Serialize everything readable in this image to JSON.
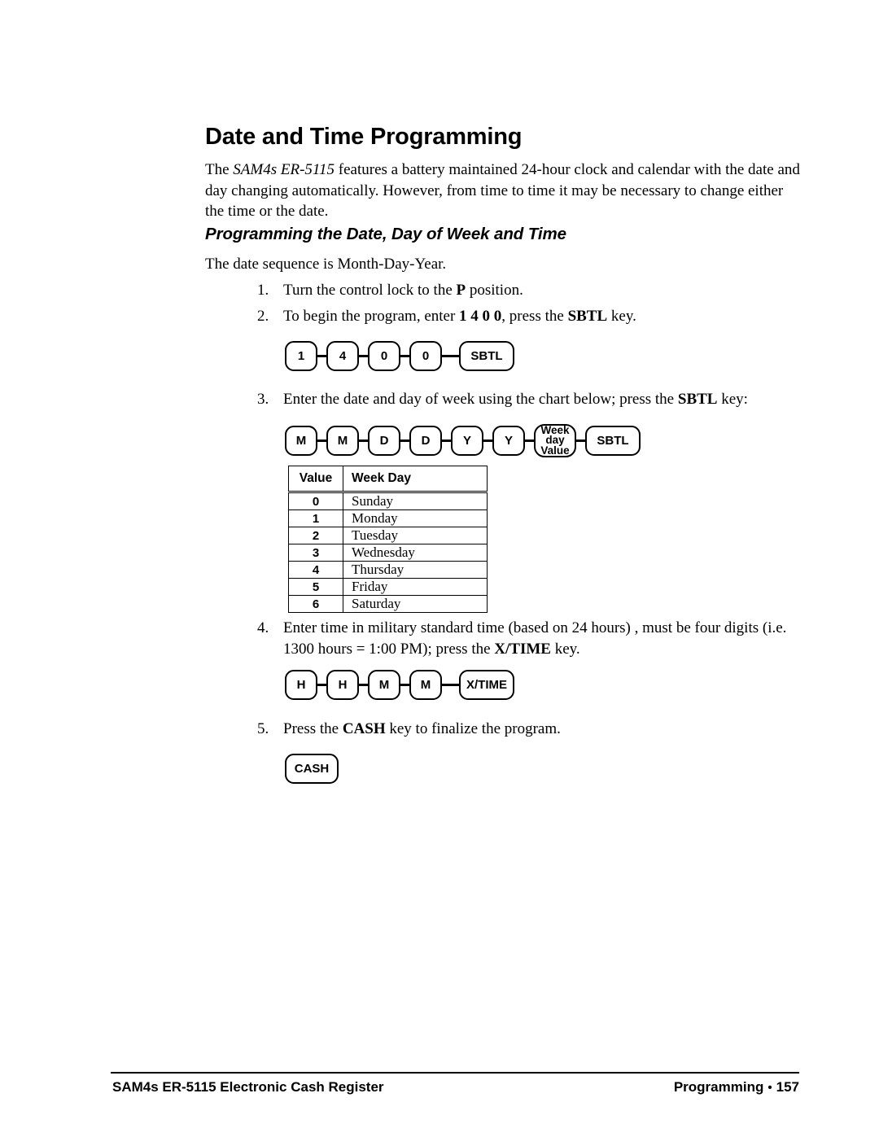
{
  "document": {
    "heading": "Date and Time Programming",
    "intro": {
      "before_italic": "The ",
      "italic_product": "SAM4s ER-5115",
      "after_italic": " features a battery maintained 24-hour clock and calendar with the date and day changing automatically.  However, from time to time it may be necessary to change either the time or the date."
    },
    "subheading": "Programming the Date, Day of Week and Time",
    "sequence_note": "The date sequence is Month-Day-Year."
  },
  "steps": [
    {
      "number": "1.",
      "text_parts": [
        "Turn the control lock to the ",
        "P",
        " position."
      ]
    },
    {
      "number": "2.",
      "text_parts": [
        "To begin the program, enter ",
        "1 4 0 0",
        ", press the ",
        "SBTL",
        " key."
      ]
    },
    {
      "number": "3.",
      "text_parts": [
        "Enter the date and day of week using the chart below; press the ",
        "SBTL",
        " key:"
      ]
    },
    {
      "number": "4.",
      "text_parts": [
        "Enter time in military standard time (based on 24 hours) , must be four digits (i.e. 1300 hours = 1:00 PM); press the ",
        "X/TIME",
        " key."
      ]
    },
    {
      "number": "5.",
      "text_parts": [
        "Press the ",
        "CASH",
        " key to finalize the program."
      ]
    }
  ],
  "key_sequences": {
    "program_entry": {
      "keys": [
        "1",
        "4",
        "0",
        "0",
        "SBTL"
      ]
    },
    "date_entry": {
      "keys": [
        "M",
        "M",
        "D",
        "D",
        "Y",
        "Y"
      ],
      "week_day_key": [
        "Week",
        "day",
        "Value"
      ],
      "final_key": "SBTL"
    },
    "time_entry": {
      "keys": [
        "H",
        "H",
        "M",
        "M"
      ],
      "final_key": "X/TIME"
    },
    "finalize": {
      "key": "CASH"
    }
  },
  "week_day_table": {
    "headers": [
      "Value",
      "Week Day"
    ],
    "rows": [
      {
        "value": "0",
        "day": "Sunday"
      },
      {
        "value": "1",
        "day": "Monday"
      },
      {
        "value": "2",
        "day": "Tuesday"
      },
      {
        "value": "3",
        "day": "Wednesday"
      },
      {
        "value": "4",
        "day": "Thursday"
      },
      {
        "value": "5",
        "day": "Friday"
      },
      {
        "value": "6",
        "day": "Saturday"
      }
    ]
  },
  "footer": {
    "left": "SAM4s ER-5115 Electronic Cash Register",
    "section": "Programming",
    "separator": "•",
    "page_number": "157"
  }
}
